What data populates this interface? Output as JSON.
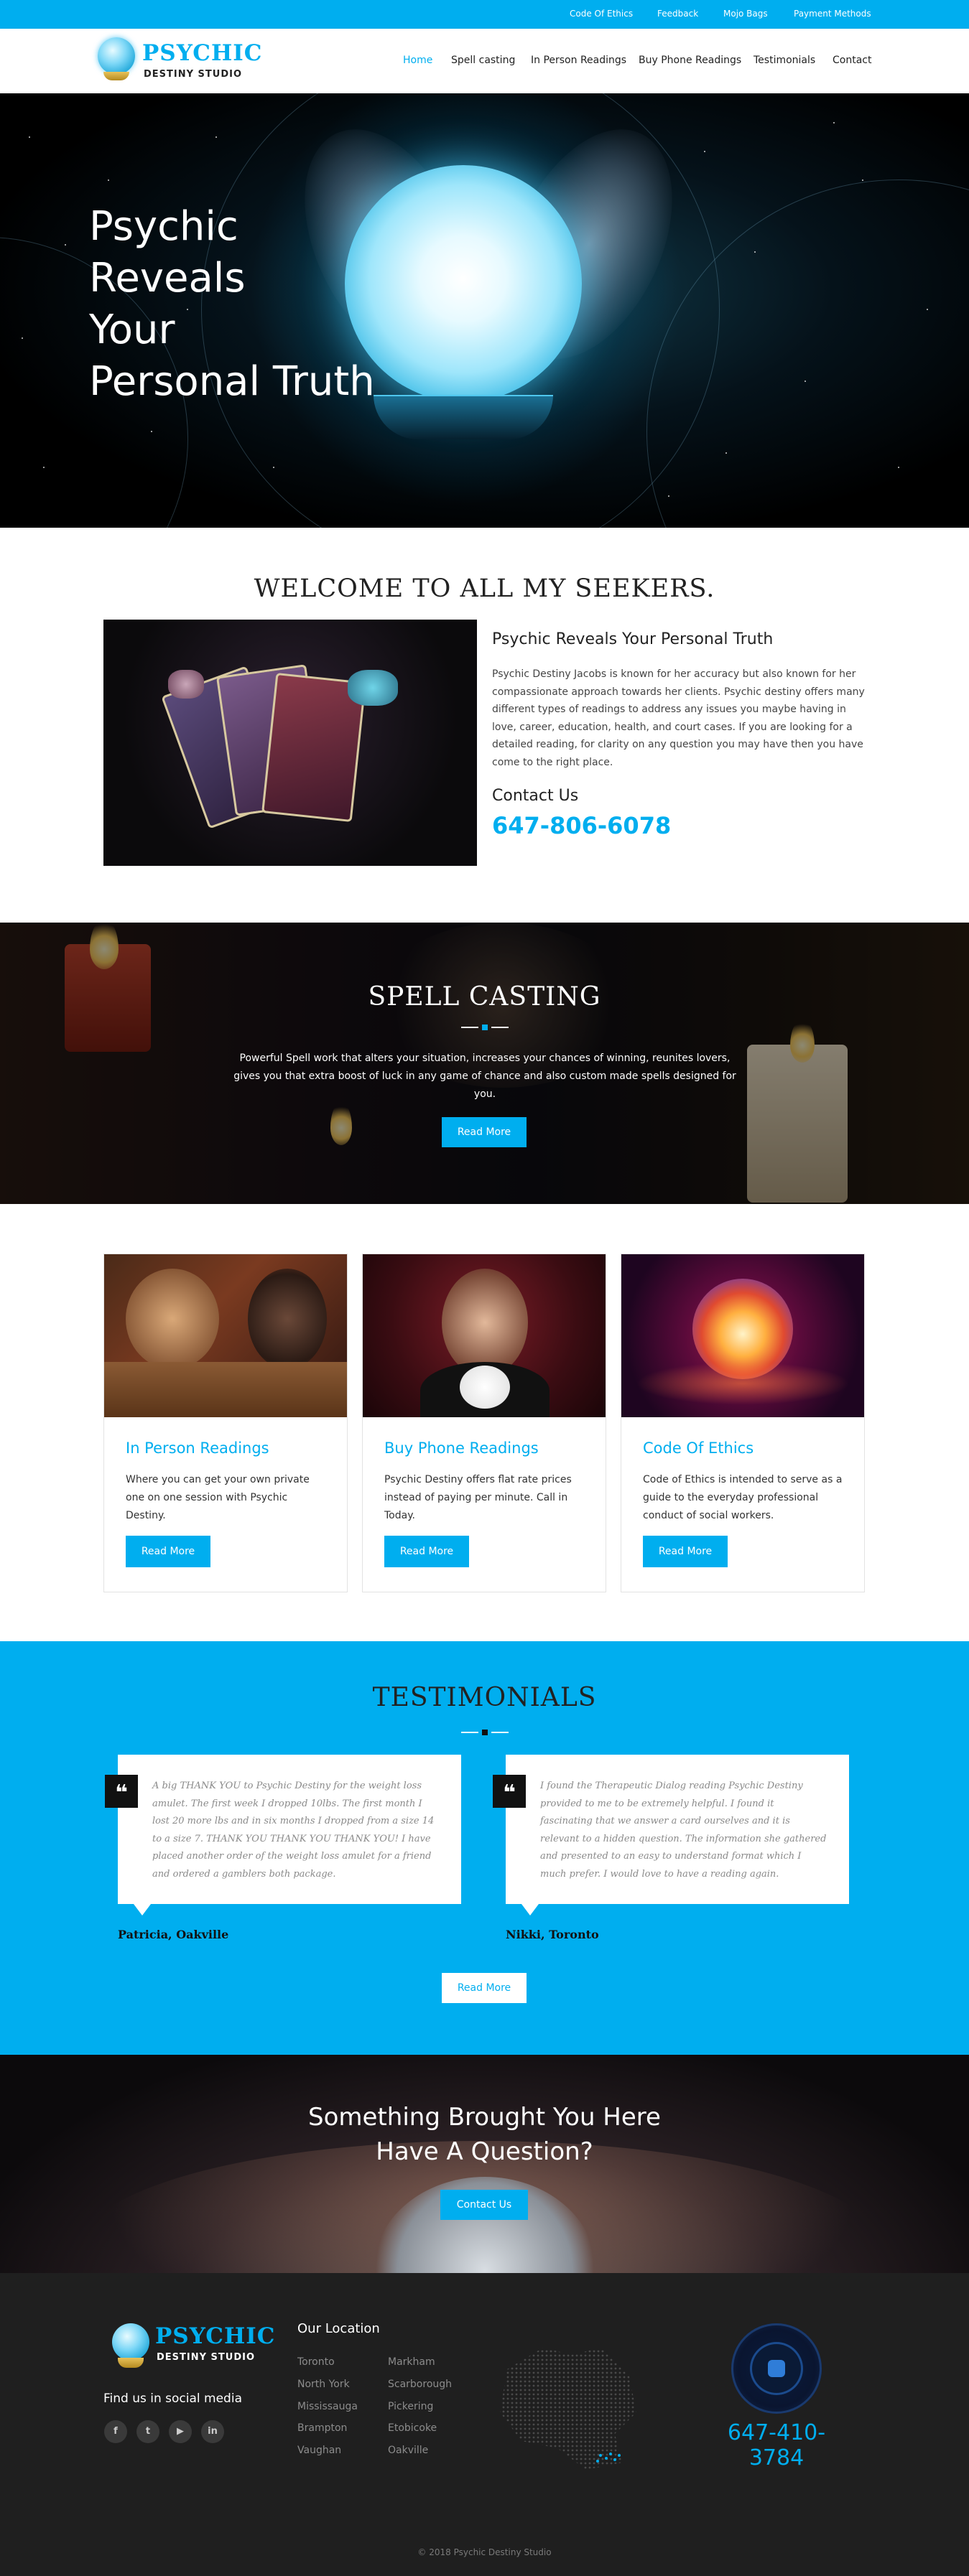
{
  "topbar": {
    "links": [
      "Code Of Ethics",
      "Feedback",
      "Mojo Bags",
      "Payment Methods"
    ]
  },
  "header": {
    "logo_title": "PSYCHIC",
    "logo_sub": "DESTINY STUDIO",
    "nav": [
      "Home",
      "Spell casting",
      "In Person Readings",
      "Buy Phone Readings",
      "Testimonials",
      "Contact"
    ],
    "active": "Home"
  },
  "hero": {
    "title_lines": [
      "Psychic",
      "Reveals",
      "Your",
      "Personal Truth"
    ]
  },
  "welcome": {
    "title": "WELCOME TO ALL MY SEEKERS.",
    "heading": "Psychic Reveals Your Personal Truth",
    "paragraph": "Psychic Destiny Jacobs is known for her accuracy but also known for her compassionate approach towards her clients. Psychic destiny offers many different types of readings to address any issues you maybe having in love, career, education, health, and court cases. If you are looking for a detailed reading, for clarity on any question you may have then you have come to the right place.",
    "contact_label": "Contact Us",
    "phone": "647-806-6078"
  },
  "spell": {
    "title": "SPELL CASTING",
    "text": "Powerful Spell work that alters your situation, increases your chances of winning, reunites lovers, gives you that extra boost of luck in any game of chance and also custom made spells designed for you.",
    "button": "Read More"
  },
  "services": [
    {
      "title": "In Person Readings",
      "text": "Where you can get your own private one on one session with Psychic Destiny.",
      "button": "Read More"
    },
    {
      "title": "Buy Phone Readings",
      "text": "Psychic Destiny offers flat rate prices instead of paying per minute. Call in Today.",
      "button": "Read More"
    },
    {
      "title": "Code Of Ethics",
      "text": "Code of Ethics is intended to serve as a guide to the everyday professional conduct of social workers.",
      "button": "Read More"
    }
  ],
  "testimonials": {
    "title": "TESTIMONIALS",
    "items": [
      {
        "text": "A big THANK YOU to Psychic Destiny for the weight loss amulet. The first week I dropped 10lbs. The first month I lost 20 more lbs and in six months I dropped from a size 14 to a size 7. THANK YOU THANK YOU THANK YOU! I have placed another order of the weight loss amulet for a friend and ordered a gamblers both package.",
        "author": "Patricia, Oakville"
      },
      {
        "text": "I found the Therapeutic Dialog reading Psychic Destiny provided to me to be extremely helpful. I found it fascinating that we answer a card ourselves and it is relevant to a hidden question. The information she gathered and presented to an easy to understand format which I much prefer. I would love to have a reading again.",
        "author": "Nikki, Toronto"
      }
    ],
    "button": "Read More"
  },
  "question": {
    "line1": "Something Brought You Here",
    "line2": "Have A Question?",
    "button": "Contact Us"
  },
  "footer": {
    "logo_title": "PSYCHIC",
    "logo_sub": "DESTINY STUDIO",
    "social_label": "Find us in social media",
    "social": [
      "f",
      "t",
      "▶",
      "in"
    ],
    "location_title": "Our Location",
    "cities_col1": [
      "Toronto",
      "North York",
      "Mississauga",
      "Brampton",
      "Vaughan"
    ],
    "cities_col2": [
      "Markham",
      "Scarborough",
      "Pickering",
      "Etobicoke",
      "Oakville"
    ],
    "phone": "647-410-3784",
    "copyright": "© 2018 Psychic Destiny Studio"
  },
  "colors": {
    "accent": "#00aeef",
    "dark": "#1f1f1f"
  }
}
